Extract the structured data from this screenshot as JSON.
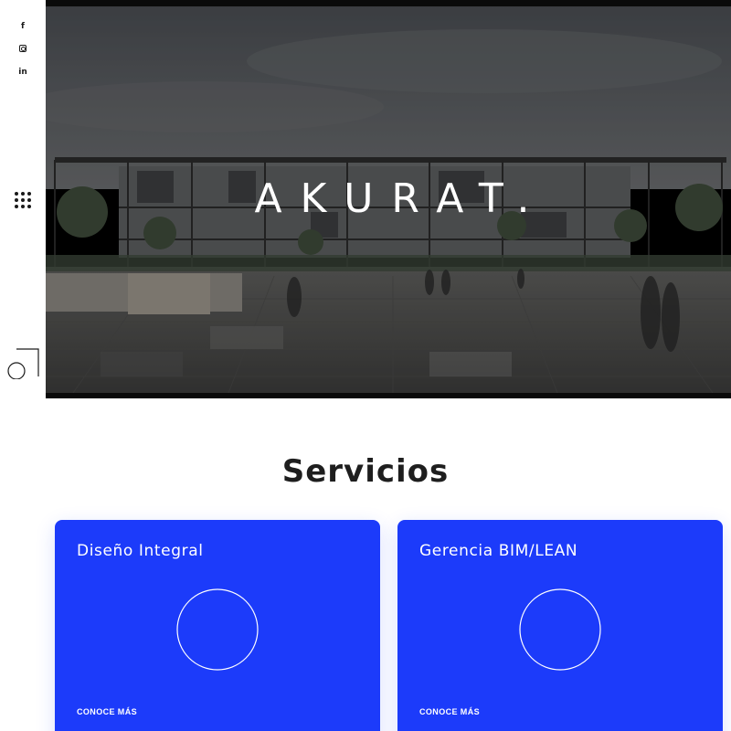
{
  "social": {
    "facebook_icon": "f",
    "instagram_icon": "instagram-icon",
    "linkedin_icon": "in"
  },
  "hero": {
    "title": "AKURAT."
  },
  "services": {
    "title": "Servicios",
    "cards": [
      {
        "title": "Diseño Integral",
        "link": "CONOCE MÁS"
      },
      {
        "title": "Gerencia BIM/LEAN",
        "link": "CONOCE MÁS"
      }
    ]
  },
  "colors": {
    "accent": "#1c3bfa",
    "text_dark": "#1e1e1e",
    "background": "#ffffff"
  }
}
